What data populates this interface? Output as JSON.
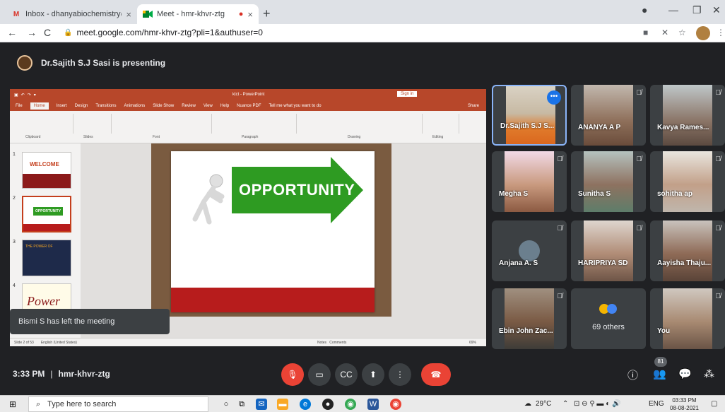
{
  "browser": {
    "tabs": [
      {
        "title": "Inbox - dhanyabiochemistry@g",
        "favicon": "gmail-icon"
      },
      {
        "title": "Meet - hmr-khvr-ztg",
        "favicon": "meet-icon",
        "recording": "●"
      }
    ],
    "url": "meet.google.com/hmr-khvr-ztg?pli=1&authuser=0"
  },
  "meet": {
    "presenting_text": "Dr.Sajith S.J Sasi is presenting",
    "toast": "Bismi S has left the meeting",
    "time": "3:33 PM",
    "separator": "|",
    "meeting_code": "hmr-khvr-ztg",
    "participant_count": "81",
    "participants": [
      {
        "name": "Dr.Sajith S.J S..."
      },
      {
        "name": "ANANYA A P"
      },
      {
        "name": "Kavya Rames..."
      },
      {
        "name": "Megha S"
      },
      {
        "name": "Sunitha S"
      },
      {
        "name": "sohitha ap"
      },
      {
        "name": "Anjana A. S"
      },
      {
        "name": "HARIPRIYA SD"
      },
      {
        "name": "Aayisha Thaju..."
      },
      {
        "name": "Ebin John Zac..."
      },
      {
        "name": "69 others"
      },
      {
        "name": "You"
      }
    ]
  },
  "ppt": {
    "title": "ktct - PowerPoint",
    "sign_in": "Sign in",
    "menu": [
      "File",
      "Home",
      "Insert",
      "Design",
      "Transitions",
      "Animations",
      "Slide Show",
      "Review",
      "View",
      "Help",
      "Nuance PDF",
      "Tell me what you want to do"
    ],
    "share": "Share",
    "groups": [
      "Clipboard",
      "Slides",
      "Font",
      "Paragraph",
      "Drawing",
      "Editing"
    ],
    "slide_numbers": [
      "1",
      "2",
      "3",
      "4"
    ],
    "slide_text": "OPPORTUNITY",
    "thumb1_text": "WELCOME",
    "thumb2_text": "OPPORTUNITY",
    "thumb3_text": "THE POWER OF",
    "thumb4_text": "Power",
    "status_left": "Slide 2 of 53",
    "status_lang": "English (United States)",
    "status_notes": "Notes",
    "status_comments": "Comments",
    "zoom": "69%"
  },
  "taskbar": {
    "search_placeholder": "Type here to search",
    "weather": "29°C",
    "lang": "ENG",
    "clock_time": "03:33 PM",
    "clock_date": "08-08-2021"
  },
  "colors": {
    "meet_bg": "#202124",
    "tile_bg": "#3c4043",
    "red": "#ea4335",
    "ppt_red": "#b7472a",
    "slide_green": "#2e9b22"
  }
}
